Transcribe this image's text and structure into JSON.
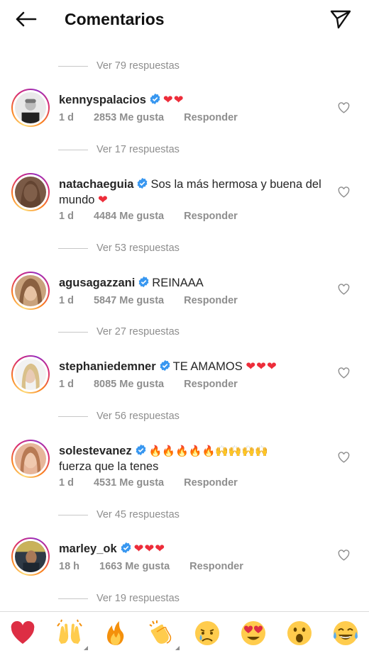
{
  "header": {
    "title": "Comentarios"
  },
  "reply_rows": [
    "Ver 79 respuestas",
    "Ver 17 respuestas",
    "Ver 53 respuestas",
    "Ver 27 respuestas",
    "Ver 56 respuestas",
    "Ver 45 respuestas",
    "Ver 19 respuestas"
  ],
  "comments": [
    {
      "username": "kennyspalacios",
      "text": "",
      "hearts": "❤❤",
      "time": "1 d",
      "likes": "2853 Me gusta",
      "reply": "Responder"
    },
    {
      "username": "natachaeguia",
      "text": "Sos la más hermosa y buena del mundo",
      "hearts": "❤",
      "time": "1 d",
      "likes": "4484 Me gusta",
      "reply": "Responder"
    },
    {
      "username": "agusagazzani",
      "text": "REINAAA",
      "hearts": "",
      "time": "1 d",
      "likes": "5847 Me gusta",
      "reply": "Responder"
    },
    {
      "username": "stephaniedemner",
      "text": "TE AMAMOS",
      "hearts": "❤❤❤",
      "time": "1 d",
      "likes": "8085 Me gusta",
      "reply": "Responder"
    },
    {
      "username": "solestevanez",
      "text": "🔥🔥🔥🔥🔥🙌🙌🙌🙌",
      "text2": "fuerza que la tenes",
      "hearts": "",
      "time": "1 d",
      "likes": "4531 Me gusta",
      "reply": "Responder"
    },
    {
      "username": "marley_ok",
      "text": "",
      "hearts": "❤❤❤",
      "time": "18 h",
      "likes": "1663 Me gusta",
      "reply": "Responder"
    }
  ],
  "emoji_bar": [
    "red-heart",
    "raising-hands",
    "fire",
    "clapping-hands",
    "crying-face",
    "heart-eyes-face",
    "surprised-face",
    "tears-of-joy-face"
  ],
  "colors": {
    "heart": "#ed2d3a",
    "verified": "#3897f0",
    "muted": "#8e8e8e"
  }
}
